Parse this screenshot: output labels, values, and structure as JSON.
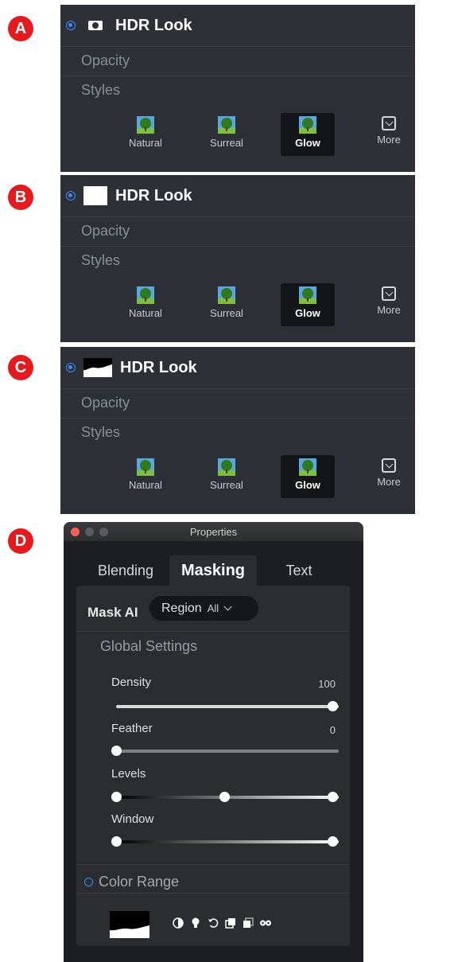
{
  "badges": [
    "A",
    "B",
    "C",
    "D"
  ],
  "panel": {
    "title": "HDR Look",
    "opacity_label": "Opacity",
    "styles_label": "Styles",
    "styles": [
      {
        "label": "Natural",
        "icon": "tree-thumbnail-icon"
      },
      {
        "label": "Surreal",
        "icon": "tree-thumbnail-icon"
      },
      {
        "label": "Glow",
        "icon": "tree-thumbnail-icon",
        "selected": true
      },
      {
        "label": "More",
        "icon": "chevron-down-box-icon"
      }
    ]
  },
  "properties": {
    "window_title": "Properties",
    "tabs": [
      "Blending",
      "Masking",
      "Text"
    ],
    "active_tab": "Masking",
    "mask_ai_label": "Mask AI",
    "region_label": "Region",
    "region_value": "All",
    "global_settings_label": "Global Settings",
    "sliders": [
      {
        "label": "Density",
        "value": "100"
      },
      {
        "label": "Feather",
        "value": "0"
      },
      {
        "label": "Levels",
        "value": ""
      },
      {
        "label": "Window",
        "value": ""
      }
    ],
    "color_range_label": "Color Range",
    "colors": {
      "accent": "#3b8cff",
      "panel": "#2d3036",
      "badge": "#e8191d"
    }
  }
}
